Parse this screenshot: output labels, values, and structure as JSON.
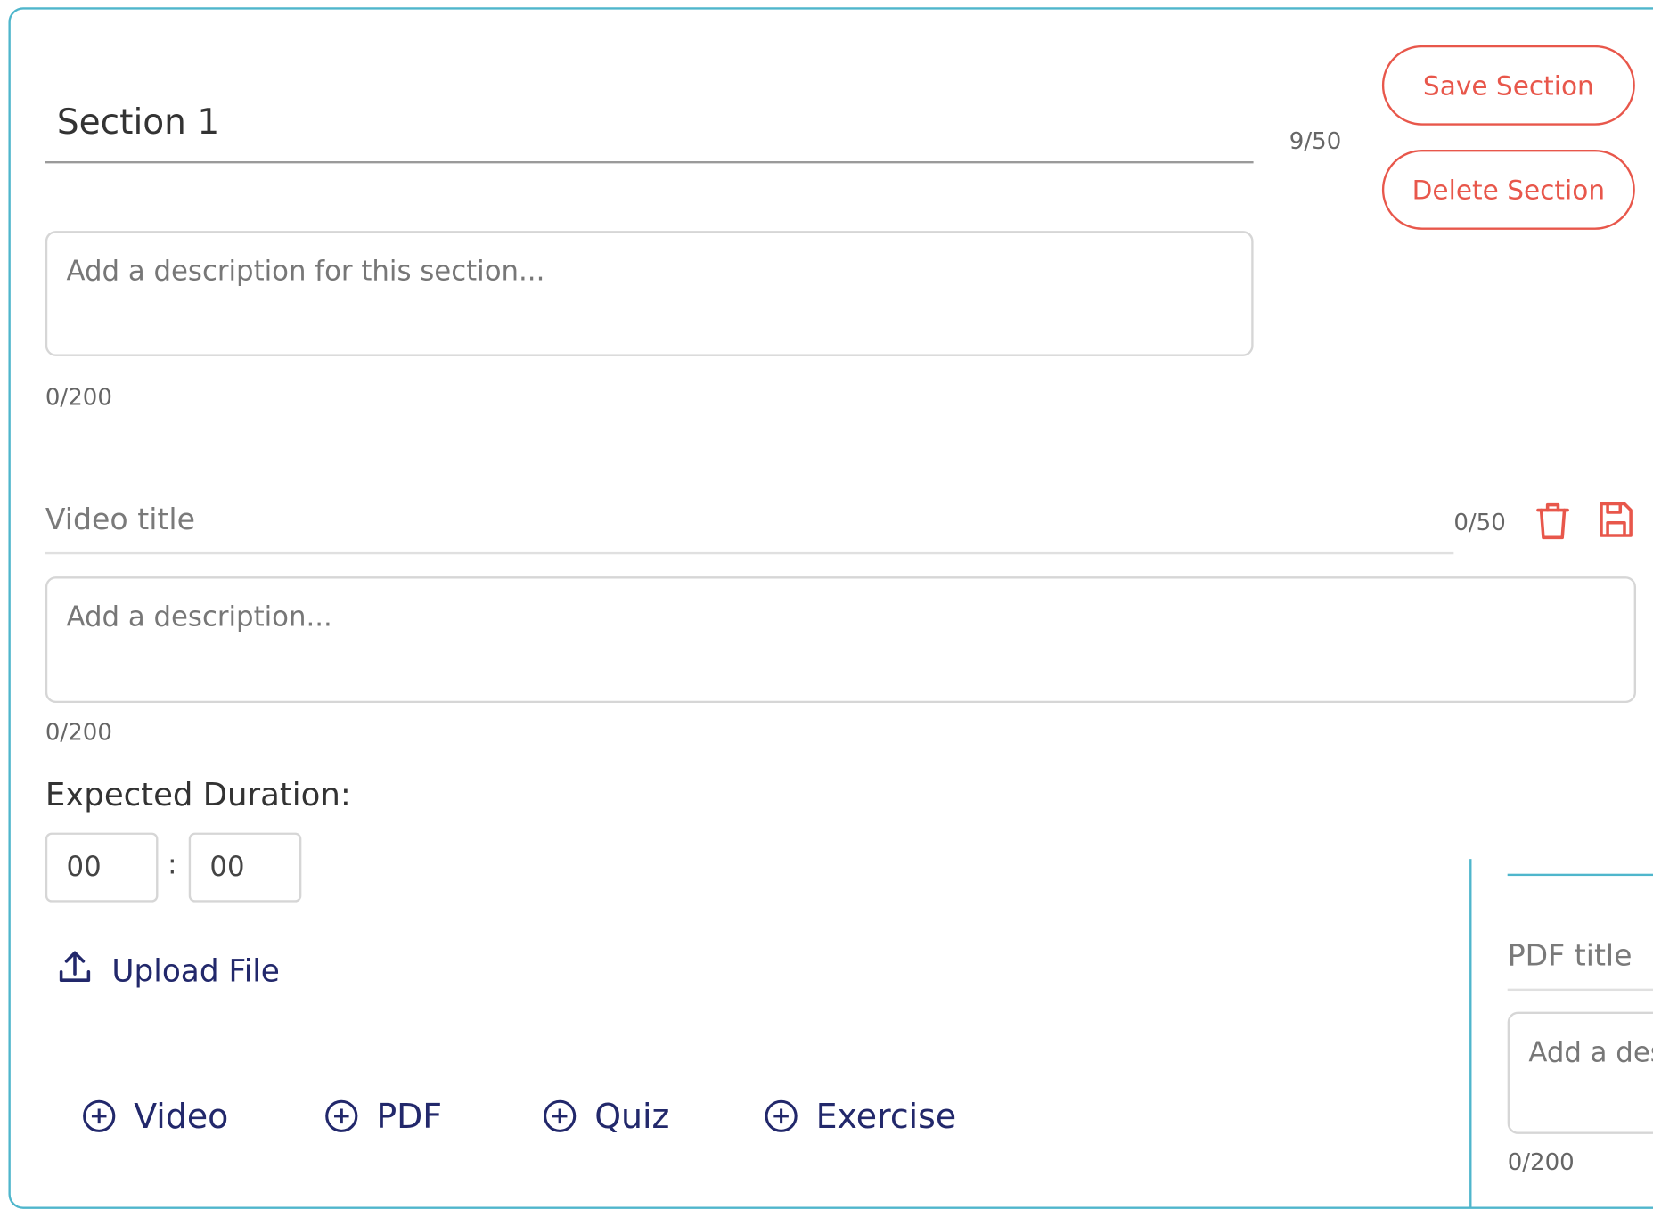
{
  "section": {
    "title_value": "Section 1",
    "title_count": "9/50",
    "save_label": "Save Section",
    "delete_label": "Delete Section",
    "description_placeholder": "Add a description for this section...",
    "description_count": "0/200"
  },
  "video": {
    "title_placeholder": "Video title",
    "title_count": "0/50",
    "description_placeholder": "Add a description...",
    "description_count": "0/200",
    "duration_label": "Expected Duration:",
    "duration_hours": "00",
    "duration_separator": ":",
    "duration_minutes": "00",
    "upload_label": "Upload File",
    "icons": [
      "trash-icon",
      "save-icon",
      "upload-icon"
    ]
  },
  "add_buttons": {
    "video": "Video",
    "pdf": "PDF",
    "quiz": "Quiz",
    "exercise": "Exercise"
  },
  "pdf": {
    "title_placeholder": "PDF title",
    "description_placeholder": "Add a description...",
    "description_count": "0/200"
  },
  "colors": {
    "accent_teal": "#4fb6cc",
    "danger_red": "#e8574b",
    "navy": "#22286b"
  }
}
